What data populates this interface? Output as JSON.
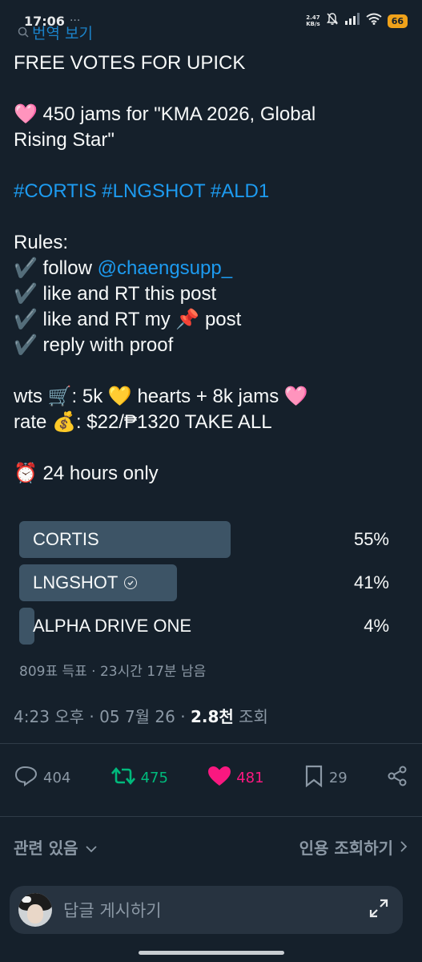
{
  "status": {
    "time": "17:06",
    "dots": "···",
    "net_speed_value": "2.47",
    "net_speed_unit": "KB/s",
    "battery": "66"
  },
  "translate_label": "번역 보기",
  "post": {
    "title": "FREE VOTES FOR UPICK",
    "line2": "🩷 450 jams for \"KMA 2026, Global",
    "line3": "Rising Star\"",
    "hashtags": "#CORTIS #LNGSHOT #ALD1",
    "rules_heading": "Rules:",
    "rule1_prefix": "✔️ follow ",
    "rule1_handle": "@chaengsupp_",
    "rule2": "✔️ like and RT this post",
    "rule3": "✔️ like and RT my 📌 post",
    "rule4": "✔️ reply with proof",
    "wts": "wts  🛒: 5k 💛 hearts + 8k jams 🩷",
    "rate": "rate 💰: $22/₱1320 TAKE ALL",
    "duration": "⏰ 24 hours only"
  },
  "poll": {
    "options": [
      {
        "label": "CORTIS",
        "percent_label": "55%",
        "percent": 55
      },
      {
        "label": "LNGSHOT",
        "percent_label": "41%",
        "percent": 41
      },
      {
        "label": "ALPHA DRIVE ONE",
        "percent_label": "4%",
        "percent": 4
      }
    ],
    "meta": "809표 득표 · 23시간 17분 남음"
  },
  "timestamp": {
    "prefix": "4:23 오후 · 05 7월 26 · ",
    "views_count": "2.8천",
    "views_suffix": " 조회"
  },
  "actions": {
    "replies": "404",
    "retweets": "475",
    "likes": "481",
    "bookmarks": "29"
  },
  "related": {
    "left_label": "관련 있음",
    "right_label": "인용 조회하기"
  },
  "reply": {
    "placeholder": "답글 게시하기"
  },
  "colors": {
    "background": "#15202b",
    "link": "#1d9bf0",
    "retweet": "#00ba7c",
    "like": "#f91880",
    "poll_bar": "#3d5466"
  }
}
